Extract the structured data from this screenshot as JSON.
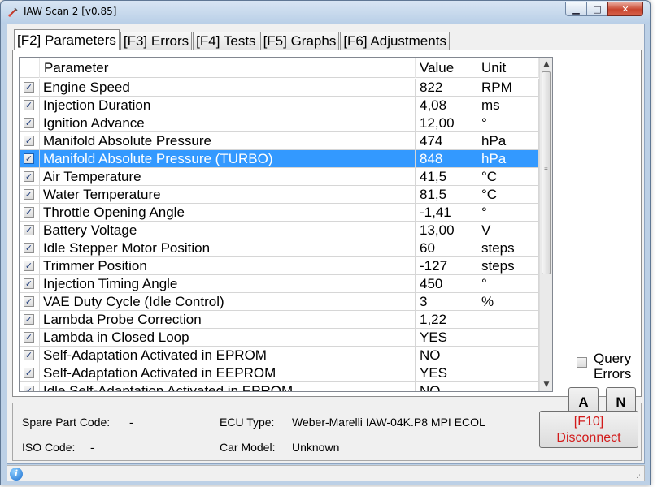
{
  "window": {
    "title": "IAW Scan 2 [v0.85]",
    "minimize_glyph": "▁",
    "maximize_glyph": "□",
    "close_glyph": "✕"
  },
  "tabs": [
    {
      "label": "[F2] Parameters",
      "active": true
    },
    {
      "label": "[F3] Errors",
      "active": false
    },
    {
      "label": "[F4] Tests",
      "active": false
    },
    {
      "label": "[F5] Graphs",
      "active": false
    },
    {
      "label": "[F6] Adjustments",
      "active": false
    }
  ],
  "grid": {
    "headers": {
      "parameter": "Parameter",
      "value": "Value",
      "unit": "Unit"
    },
    "check_glyph": "✓",
    "selected_row_index": 4,
    "rows": [
      {
        "name": "Engine Speed",
        "value": "822",
        "unit": "RPM"
      },
      {
        "name": "Injection Duration",
        "value": "4,08",
        "unit": "ms"
      },
      {
        "name": "Ignition Advance",
        "value": "12,00",
        "unit": "°"
      },
      {
        "name": "Manifold Absolute Pressure",
        "value": "474",
        "unit": "hPa"
      },
      {
        "name": "Manifold Absolute Pressure (TURBO)",
        "value": "848",
        "unit": "hPa"
      },
      {
        "name": "Air Temperature",
        "value": "41,5",
        "unit": "°C"
      },
      {
        "name": "Water Temperature",
        "value": "81,5",
        "unit": "°C"
      },
      {
        "name": "Throttle Opening Angle",
        "value": "-1,41",
        "unit": "°"
      },
      {
        "name": "Battery Voltage",
        "value": "13,00",
        "unit": "V"
      },
      {
        "name": "Idle Stepper Motor Position",
        "value": "60",
        "unit": "steps"
      },
      {
        "name": "Trimmer Position",
        "value": "-127",
        "unit": "steps"
      },
      {
        "name": "Injection Timing Angle",
        "value": "450",
        "unit": "°"
      },
      {
        "name": "VAE Duty Cycle (Idle Control)",
        "value": "3",
        "unit": "%"
      },
      {
        "name": "Lambda Probe Correction",
        "value": "1,22",
        "unit": ""
      },
      {
        "name": "Lambda in Closed Loop",
        "value": "YES",
        "unit": ""
      },
      {
        "name": "Self-Adaptation Activated in EPROM",
        "value": "NO",
        "unit": ""
      },
      {
        "name": "Self-Adaptation Activated in EEPROM",
        "value": "YES",
        "unit": ""
      },
      {
        "name": "Idle Self-Adaptation Activated in EPROM",
        "value": "NO",
        "unit": ""
      }
    ]
  },
  "side": {
    "query_errors_label": "Query Errors",
    "btn_a": "A",
    "btn_n": "N"
  },
  "info": {
    "spare_part_label": "Spare Part Code:",
    "spare_part_value": "-",
    "iso_label": "ISO Code:",
    "iso_value": "-",
    "ecu_type_label": "ECU Type:",
    "ecu_type_value": "Weber-Marelli IAW-04K.P8 MPI ECOL",
    "car_model_label": "Car Model:",
    "car_model_value": "Unknown",
    "disconnect_line1": "[F10]",
    "disconnect_line2": "Disconnect"
  },
  "statusbar": {
    "info_glyph": "i"
  }
}
